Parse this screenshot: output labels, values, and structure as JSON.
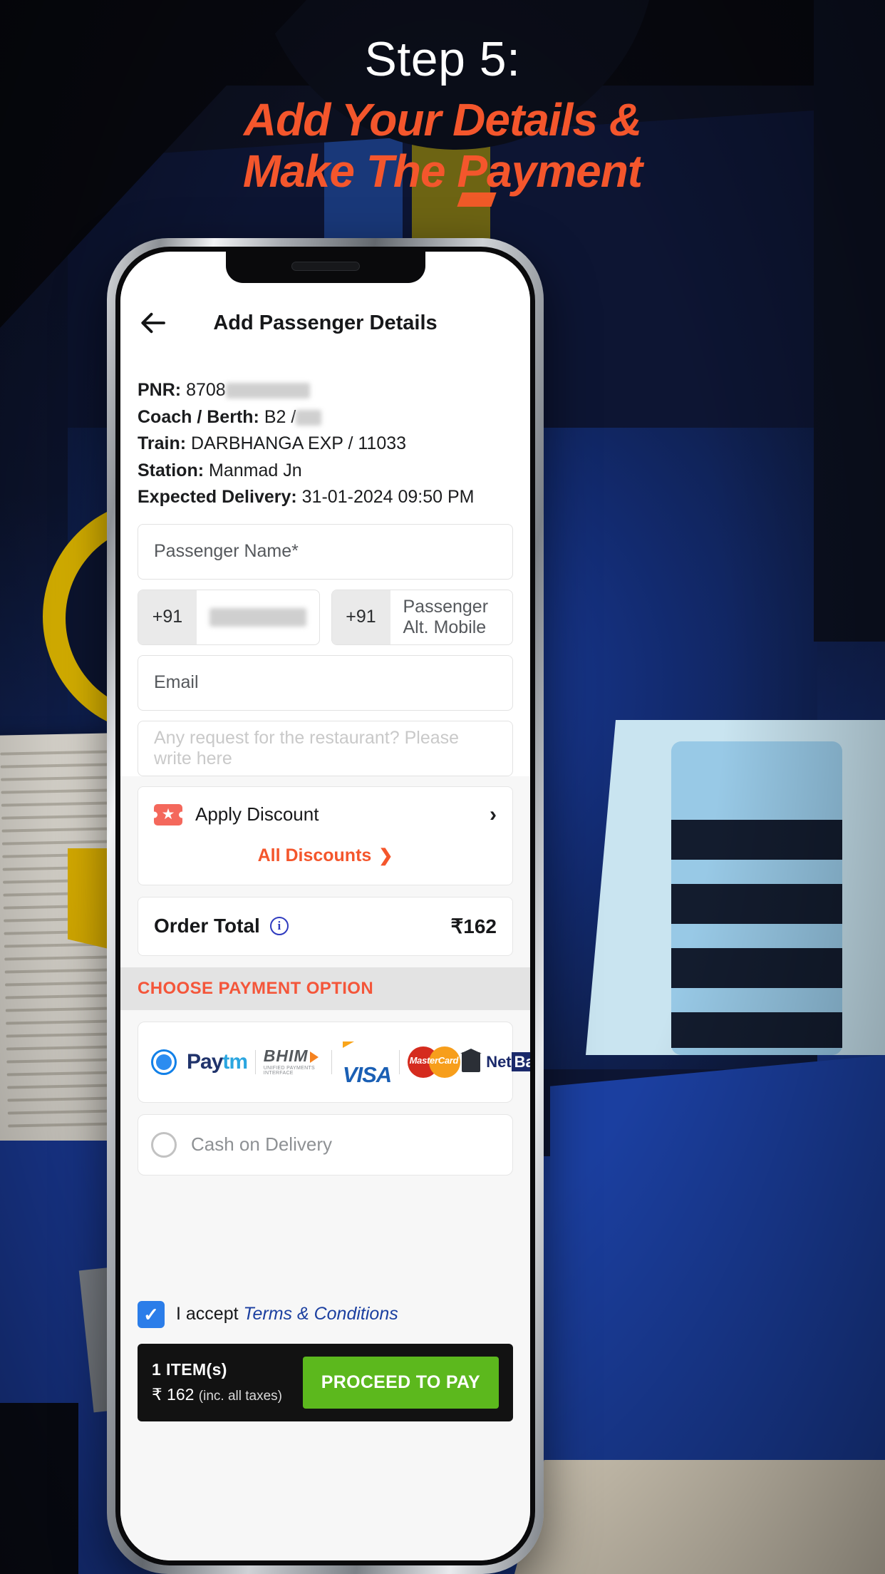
{
  "poster": {
    "step_title": "Step 5:",
    "headline_line1": "Add Your Details &",
    "headline_line2": "Make The Payment",
    "accent_color": "#f4562c"
  },
  "app": {
    "header": {
      "back_icon": "arrow-left-icon",
      "title": "Add Passenger Details"
    },
    "booking_info": [
      {
        "label": "PNR:",
        "value": "8708",
        "redacted": true
      },
      {
        "label": "Coach / Berth:",
        "value": "B2 /",
        "redacted": true
      },
      {
        "label": "Train:",
        "value": "DARBHANGA EXP / 11033",
        "redacted": false
      },
      {
        "label": "Station:",
        "value": "Manmad Jn",
        "redacted": false
      },
      {
        "label": "Expected Delivery:",
        "value": "31-01-2024 09:50 PM",
        "redacted": false
      }
    ],
    "form": {
      "passenger_name_placeholder": "Passenger Name*",
      "mobile_country_code": "+91",
      "mobile_value": "",
      "alt_country_code": "+91",
      "alt_mobile_placeholder": "Passenger Alt. Mobile",
      "email_placeholder": "Email",
      "request_placeholder": "Any request for the restaurant? Please write here"
    },
    "discount": {
      "icon": "ticket-star-icon",
      "label": "Apply Discount",
      "chevron": "chevron-right-icon",
      "all_discounts_label": "All Discounts",
      "all_discounts_chevron": "chevron-right-icon"
    },
    "order_total": {
      "label": "Order Total",
      "info_icon": "info-circle-icon",
      "info_glyph": "i",
      "amount": "₹162"
    },
    "payment": {
      "section_title": "CHOOSE PAYMENT OPTION",
      "online_option": {
        "selected": true,
        "radio_name": "radio-online-selected",
        "logos": [
          {
            "name": "paytm-logo",
            "text_a": "Pay",
            "text_b": "tm"
          },
          {
            "name": "bhim-logo",
            "text": "BHIM",
            "subtitle": "UNIFIED PAYMENTS INTERFACE"
          },
          {
            "name": "visa-logo",
            "text": "VISA"
          },
          {
            "name": "mastercard-logo",
            "text": "MasterCard"
          },
          {
            "name": "netbanking-logo",
            "text_a": "Net",
            "text_b": "Banking"
          }
        ]
      },
      "cod_option": {
        "selected": false,
        "radio_name": "radio-cash-on-delivery",
        "label": "Cash on Delivery"
      }
    },
    "terms": {
      "checked": true,
      "check_glyph": "✓",
      "prefix": "I accept ",
      "link": "Terms & Conditions"
    },
    "pay_bar": {
      "items_label": "1 ITEM(s)",
      "amount": "₹ 162",
      "tax_note": "(inc. all taxes)",
      "button_label": "PROCEED TO PAY",
      "button_color": "#5cb81d"
    }
  }
}
